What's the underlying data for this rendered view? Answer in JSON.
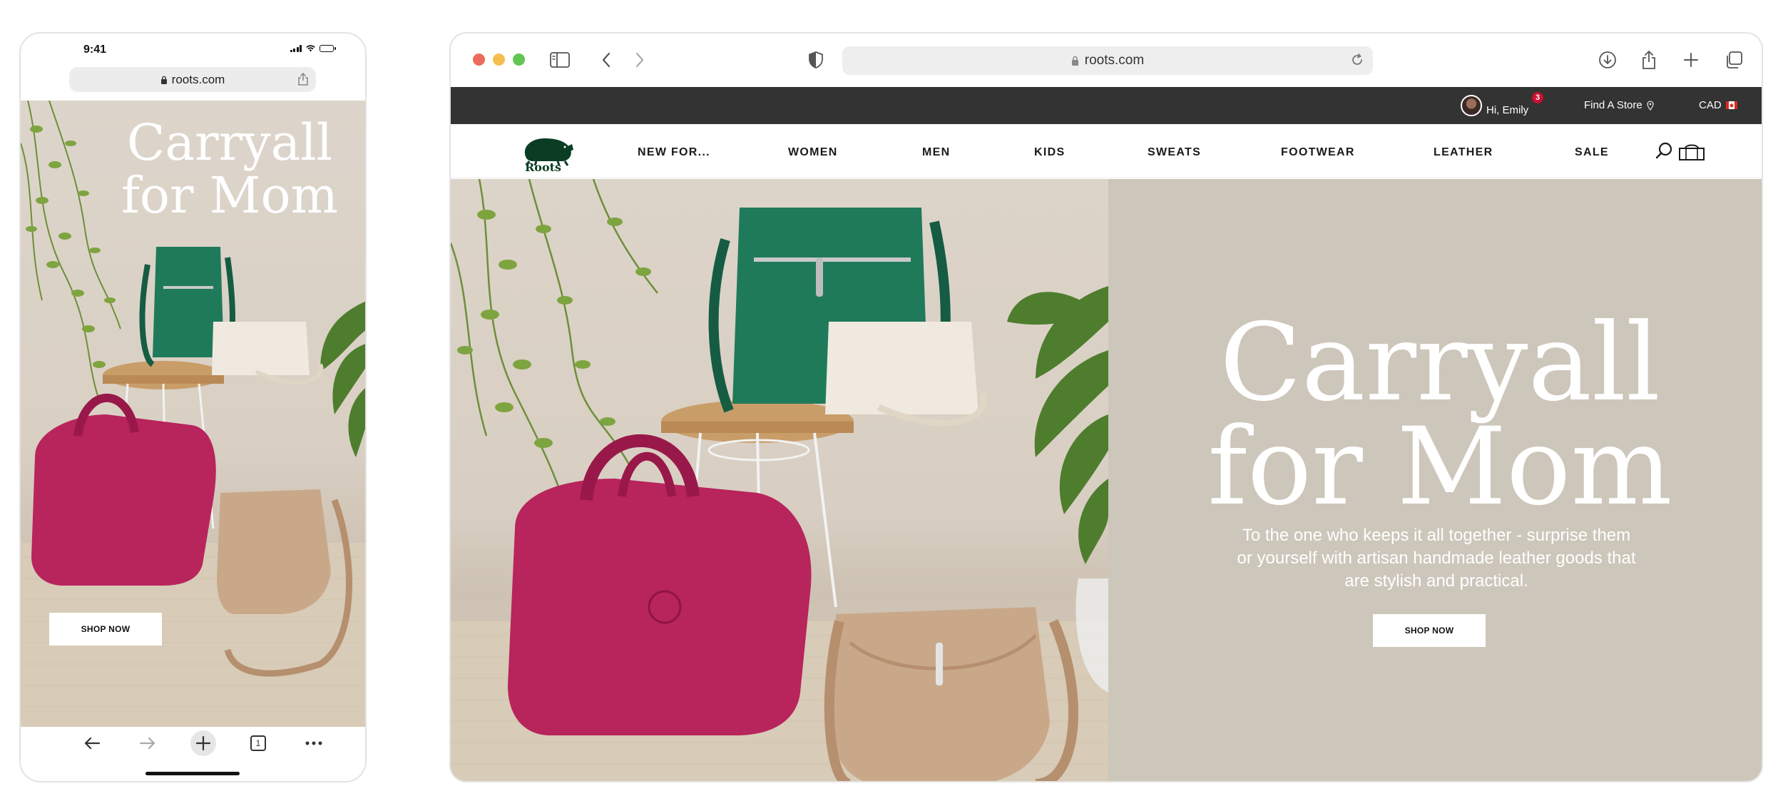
{
  "phone": {
    "time": "9:41",
    "url": "roots.com",
    "hero": {
      "title_line1": "Carryall",
      "title_line2": "for Mom",
      "cta": "SHOP NOW"
    },
    "toolbar": {
      "tabs_count": "1"
    }
  },
  "desktop": {
    "url": "roots.com",
    "util": {
      "greeting": "Hi, Emily",
      "notifications": "3",
      "store": "Find A Store",
      "currency": "CAD"
    },
    "logo_text": "Roots",
    "nav": [
      {
        "label": "NEW FOR..."
      },
      {
        "label": "WOMEN"
      },
      {
        "label": "MEN"
      },
      {
        "label": "KIDS"
      },
      {
        "label": "SWEATS"
      },
      {
        "label": "FOOTWEAR"
      },
      {
        "label": "LEATHER"
      },
      {
        "label": "SALE"
      }
    ],
    "hero": {
      "title_line1": "Carryall",
      "title_line2": "for Mom",
      "copy": "To the one who keeps it all together - surprise them or yourself with artisan handmade leather goods that are stylish and practical.",
      "cta": "SHOP NOW"
    }
  },
  "colors": {
    "util_bar": "#333333",
    "hero_panel": "#cdc6ba",
    "brand_green": "#0b3d24",
    "bag_green": "#1f7a5a",
    "bag_pink": "#b8245c",
    "bag_tan": "#c9a88a",
    "bag_cream": "#efe9df"
  }
}
